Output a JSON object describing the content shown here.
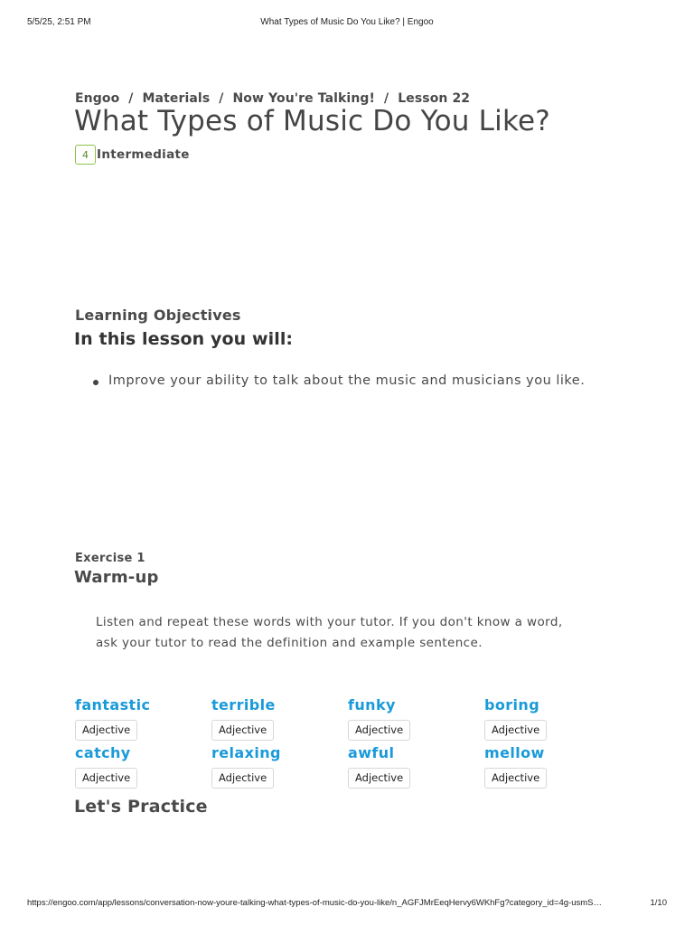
{
  "print_header": {
    "datetime": "5/5/25, 2:51 PM",
    "page_title": "What Types of Music Do You Like? | Engoo"
  },
  "breadcrumb": {
    "items": [
      "Engoo",
      "Materials",
      "Now You're Talking!",
      "Lesson 22"
    ],
    "separator": "/"
  },
  "lesson": {
    "title": "What Types of Music Do You Like?",
    "level_number": "4",
    "level_name": "Intermediate"
  },
  "objectives": {
    "label": "Learning Objectives",
    "heading": "In this lesson you will:",
    "items": [
      "Improve your ability to talk about the music and musicians you like."
    ]
  },
  "exercise": {
    "label": "Exercise 1",
    "heading": "Warm-up",
    "instructions": "Listen and repeat these words with your tutor. If you don't know a word, ask your tutor to read the definition and example sentence.",
    "vocab": [
      {
        "word": "fantastic",
        "pos": "Adjective"
      },
      {
        "word": "terrible",
        "pos": "Adjective"
      },
      {
        "word": "funky",
        "pos": "Adjective"
      },
      {
        "word": "boring",
        "pos": "Adjective"
      },
      {
        "word": "catchy",
        "pos": "Adjective"
      },
      {
        "word": "relaxing",
        "pos": "Adjective"
      },
      {
        "word": "awful",
        "pos": "Adjective"
      },
      {
        "word": "mellow",
        "pos": "Adjective"
      }
    ]
  },
  "practice": {
    "heading": "Let's Practice"
  },
  "print_footer": {
    "url": "https://engoo.com/app/lessons/conversation-now-youre-talking-what-types-of-music-do-you-like/n_AGFJMrEeqHervy6WKhFg?category_id=4g-usmS…",
    "page": "1/10"
  },
  "colors": {
    "vocab_word": "#1a9ad9",
    "level_badge_border": "#8bc34a",
    "text": "#4a4a4a"
  }
}
